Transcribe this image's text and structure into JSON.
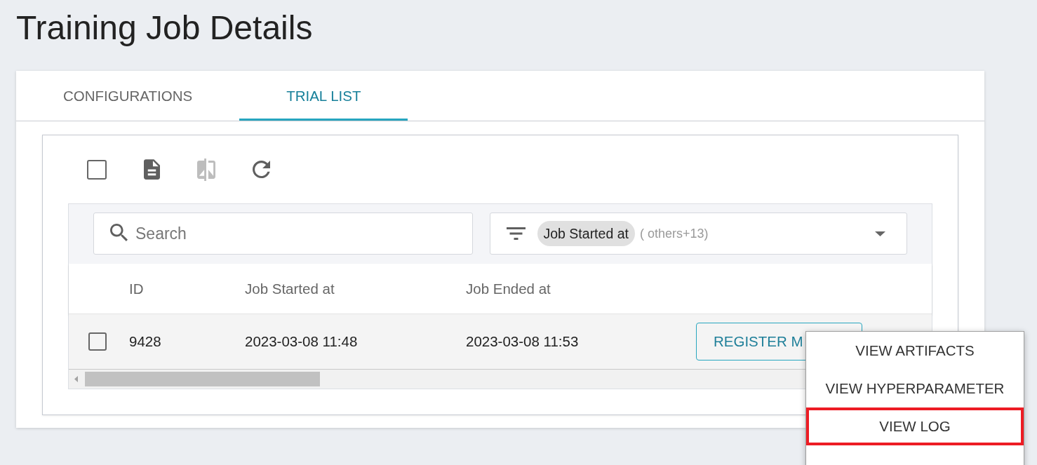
{
  "page": {
    "title": "Training Job Details"
  },
  "tabs": [
    {
      "label": "CONFIGURATIONS",
      "selected": false
    },
    {
      "label": "TRIAL LIST",
      "selected": true
    }
  ],
  "toolbar": {
    "select_all": {
      "checked": false
    },
    "buttons": [
      {
        "kind": "document",
        "disabled": false
      },
      {
        "kind": "compare",
        "disabled": true
      },
      {
        "kind": "refresh",
        "disabled": false
      }
    ]
  },
  "search": {
    "placeholder": "Search"
  },
  "column_filter": {
    "chip": "Job Started at",
    "more": "( others+13)"
  },
  "table": {
    "columns": [
      "ID",
      "Job Started at",
      "Job Ended at"
    ],
    "rows": [
      {
        "checked": false,
        "id": "9428",
        "started": "2023-03-08 11:48",
        "ended": "2023-03-08 11:53",
        "action": "REGISTER M"
      }
    ]
  },
  "menu": {
    "items": [
      {
        "label": "VIEW ARTIFACTS",
        "highlighted": false
      },
      {
        "label": "VIEW HYPERPARAMETER",
        "highlighted": false
      },
      {
        "label": "VIEW LOG",
        "highlighted": true
      }
    ]
  }
}
